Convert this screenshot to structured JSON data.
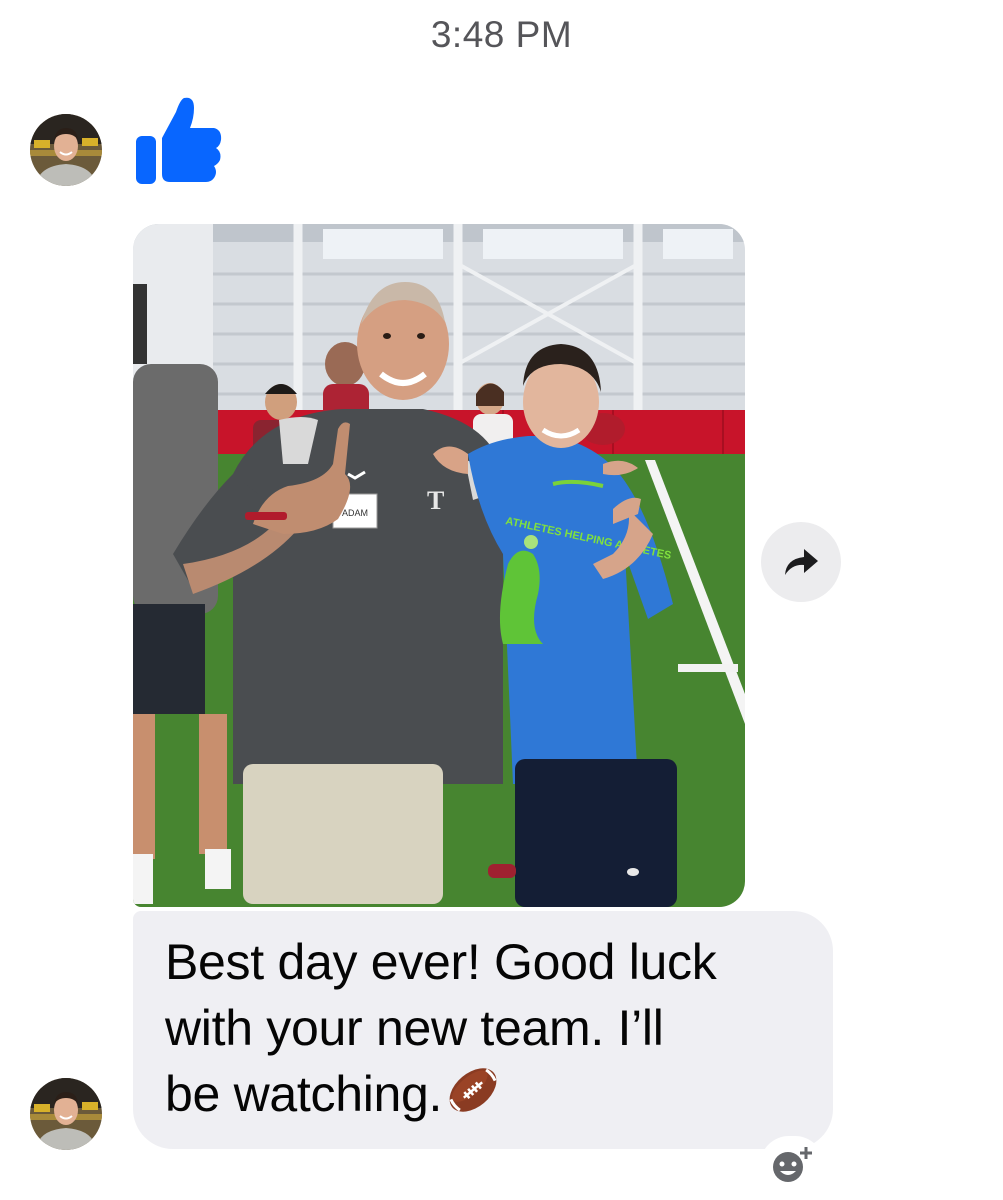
{
  "header": {
    "timestamp": "3:48 PM"
  },
  "thread": {
    "messages": [
      {
        "type": "reaction",
        "icon": "thumbs-up-icon",
        "color": "#0866ff"
      },
      {
        "type": "photo",
        "description_icon": "shared-photo"
      },
      {
        "type": "text",
        "text": "Best day ever! Good luck\nwith your new team. I’ll\nbe watching.",
        "trailing_emoji": "football-emoji"
      }
    ]
  },
  "photo_content": {
    "name_tag": "ADAM",
    "shirt_text": "ATHLETES HELPING ATHLETES"
  },
  "actions": {
    "share_icon": "share-arrow-icon",
    "react_icon": "add-reaction-icon"
  },
  "colors": {
    "accent": "#0866ff",
    "bubble": "#efeff3",
    "timestamp": "#555559"
  }
}
